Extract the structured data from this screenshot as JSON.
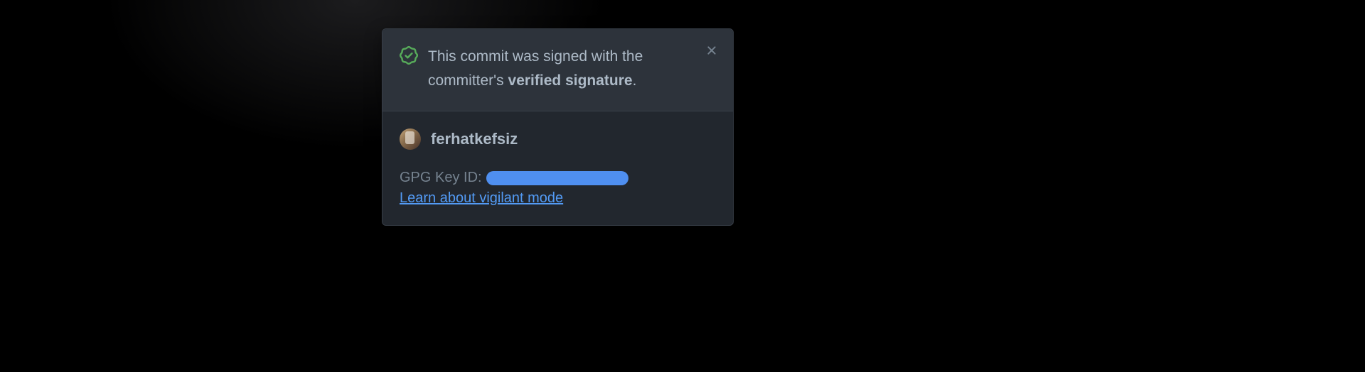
{
  "header": {
    "message_part1": "This commit was signed with the committer's ",
    "message_bold": "verified signature",
    "message_part2": "."
  },
  "user": {
    "username": "ferhatkefsiz"
  },
  "gpg": {
    "label": "GPG Key ID: "
  },
  "link": {
    "vigilant_mode": "Learn about vigilant mode"
  }
}
